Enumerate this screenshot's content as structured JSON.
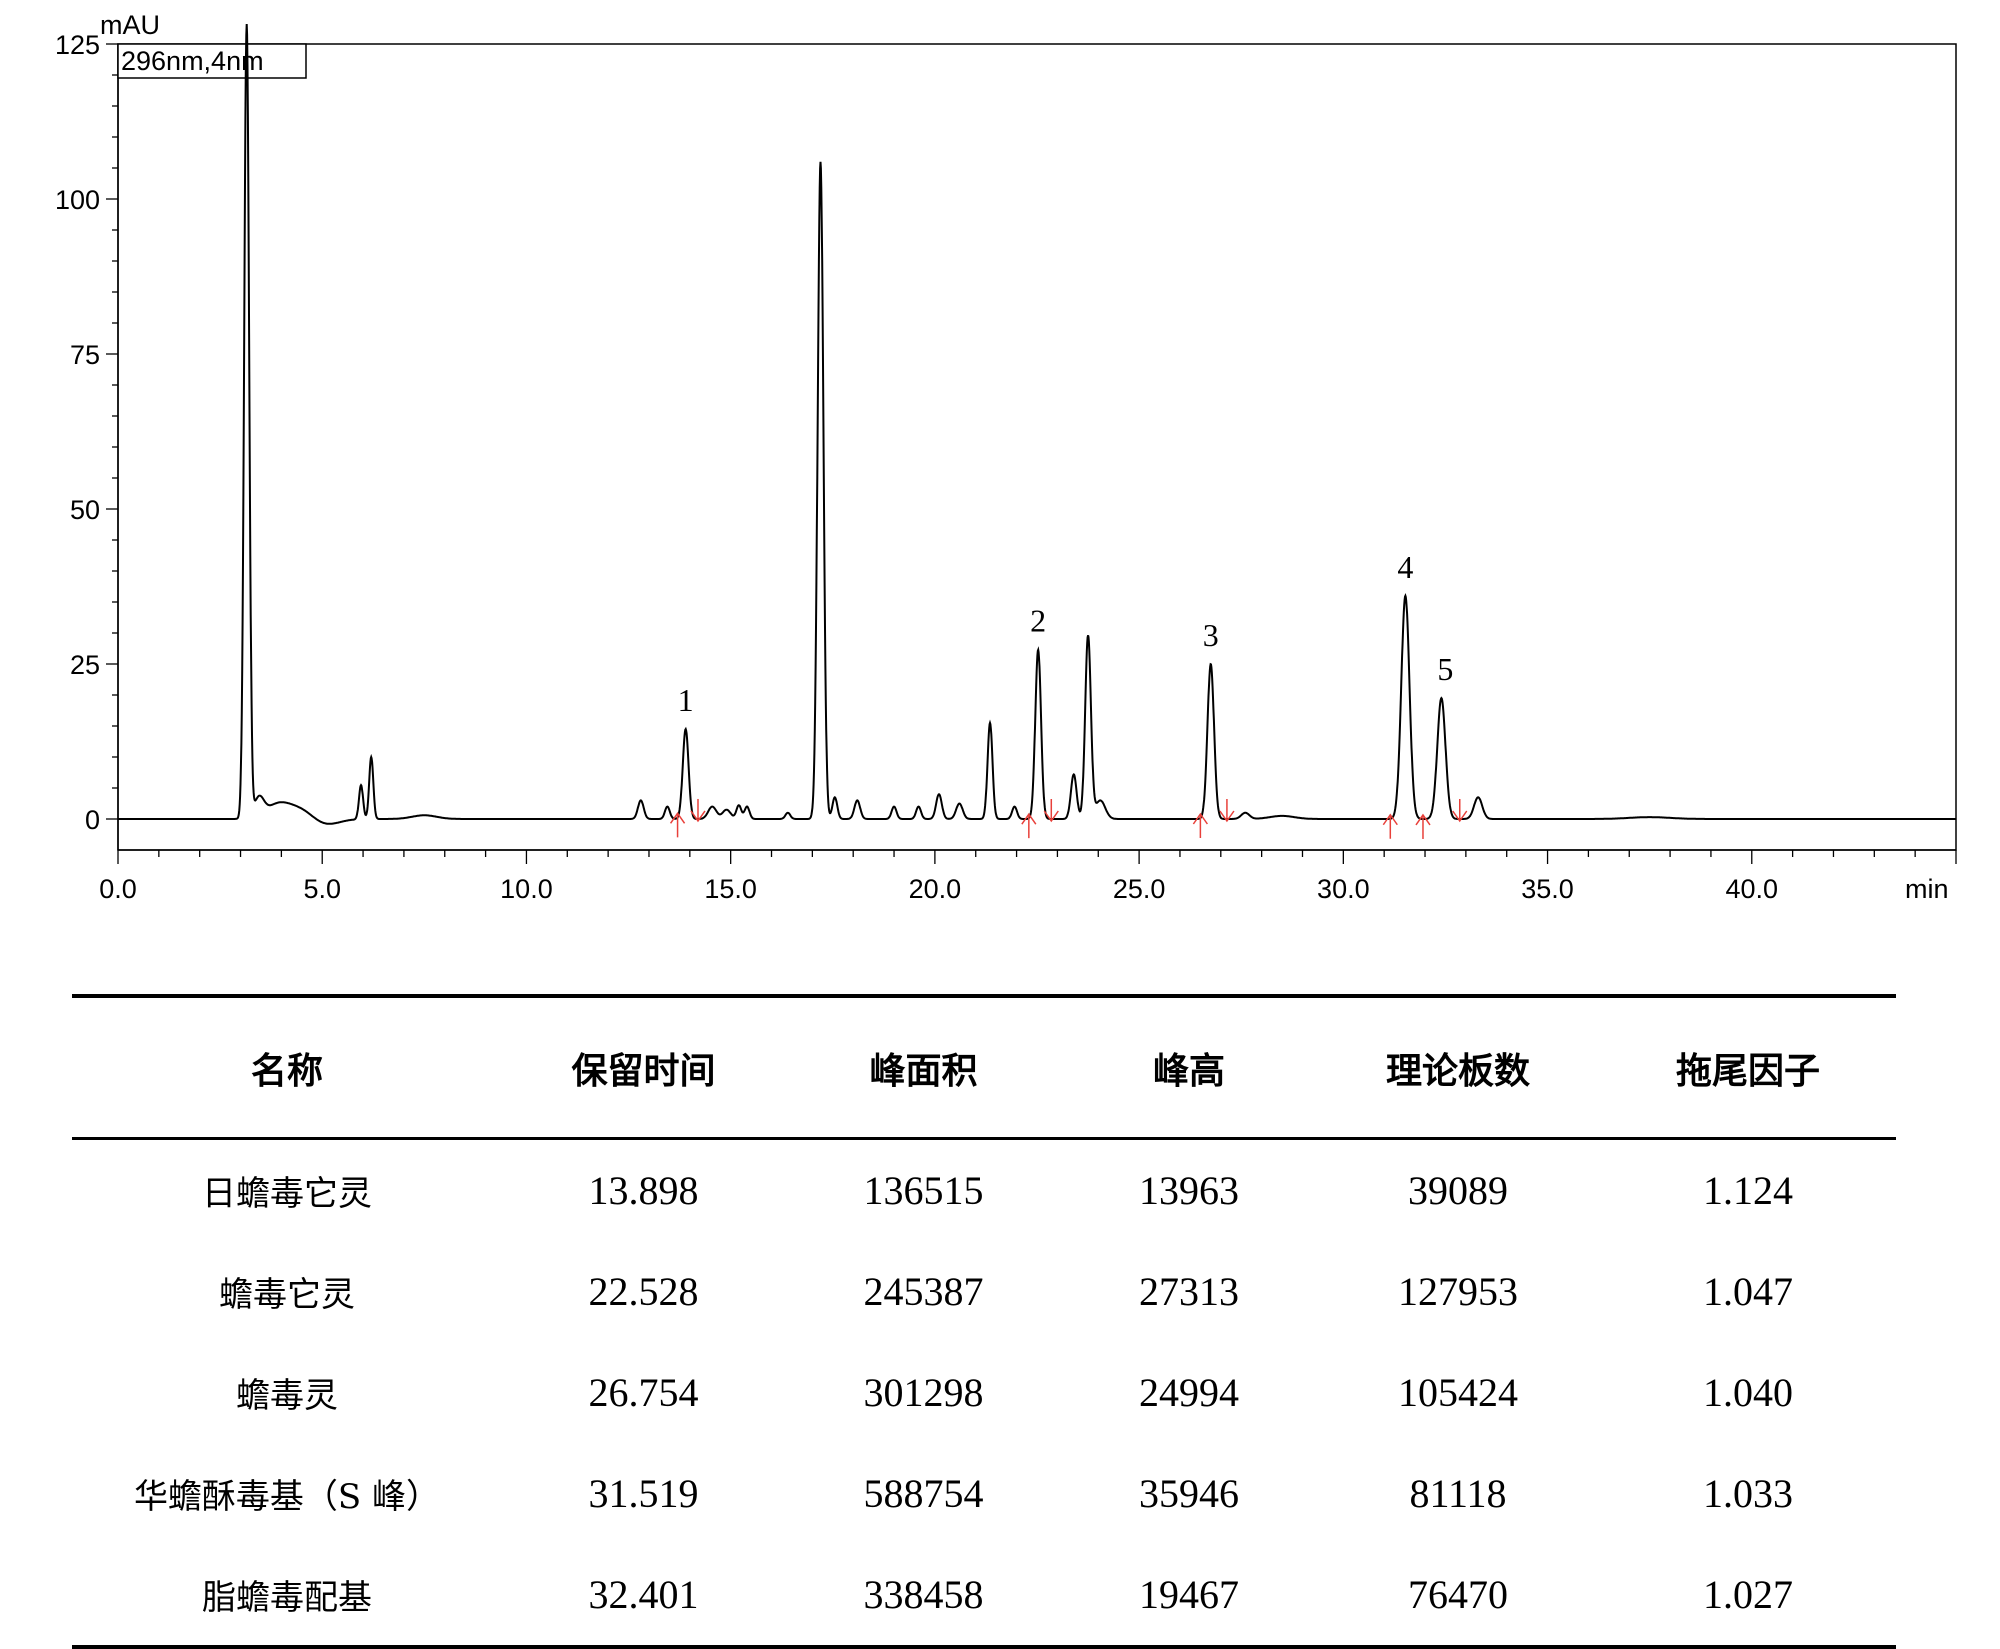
{
  "chart_data": {
    "type": "line",
    "y_unit": "mAU",
    "x_unit": "min",
    "legend": "296nm,4nm",
    "xlim": [
      0,
      45
    ],
    "ylim": [
      -5,
      125
    ],
    "x_ticks": [
      "0.0",
      "5.0",
      "10.0",
      "15.0",
      "20.0",
      "25.0",
      "30.0",
      "35.0",
      "40.0"
    ],
    "y_ticks": [
      "0",
      "25",
      "50",
      "75",
      "100",
      "125"
    ],
    "line_color": "#000000",
    "marker_color": "#e8403a",
    "peaks": [
      {
        "t": 3.15,
        "h": 128,
        "w": 0.06
      },
      {
        "t": 3.45,
        "h": 3,
        "w": 0.12
      },
      {
        "t": 3.9,
        "h": 2.2,
        "w": 0.3
      },
      {
        "t": 4.5,
        "h": 1.8,
        "w": 0.35
      },
      {
        "t": 5.95,
        "h": 5.5,
        "w": 0.05
      },
      {
        "t": 6.2,
        "h": 10,
        "w": 0.05
      },
      {
        "t": 7.5,
        "h": 0.6,
        "w": 0.3
      },
      {
        "t": 12.8,
        "h": 3,
        "w": 0.07
      },
      {
        "t": 13.45,
        "h": 2,
        "w": 0.06
      },
      {
        "t": 13.898,
        "h": 14.5,
        "w": 0.07
      },
      {
        "t": 14.55,
        "h": 2,
        "w": 0.1
      },
      {
        "t": 14.9,
        "h": 1.5,
        "w": 0.1
      },
      {
        "t": 15.2,
        "h": 2.2,
        "w": 0.06
      },
      {
        "t": 15.4,
        "h": 2,
        "w": 0.06
      },
      {
        "t": 16.4,
        "h": 1,
        "w": 0.06
      },
      {
        "t": 17.2,
        "h": 106,
        "w": 0.07
      },
      {
        "t": 17.55,
        "h": 3.5,
        "w": 0.06
      },
      {
        "t": 18.1,
        "h": 3,
        "w": 0.07
      },
      {
        "t": 19.0,
        "h": 2,
        "w": 0.06
      },
      {
        "t": 19.6,
        "h": 2,
        "w": 0.06
      },
      {
        "t": 20.1,
        "h": 4,
        "w": 0.07
      },
      {
        "t": 20.6,
        "h": 2.5,
        "w": 0.08
      },
      {
        "t": 21.35,
        "h": 15.5,
        "w": 0.06
      },
      {
        "t": 21.95,
        "h": 2,
        "w": 0.06
      },
      {
        "t": 22.528,
        "h": 27.3,
        "w": 0.07
      },
      {
        "t": 23.4,
        "h": 7.2,
        "w": 0.07
      },
      {
        "t": 23.75,
        "h": 29.5,
        "w": 0.07
      },
      {
        "t": 24.05,
        "h": 3,
        "w": 0.12
      },
      {
        "t": 26.754,
        "h": 25,
        "w": 0.08
      },
      {
        "t": 27.6,
        "h": 1,
        "w": 0.1
      },
      {
        "t": 28.5,
        "h": 0.5,
        "w": 0.3
      },
      {
        "t": 31.519,
        "h": 36,
        "w": 0.1
      },
      {
        "t": 32.401,
        "h": 19.5,
        "w": 0.1
      },
      {
        "t": 33.3,
        "h": 3.5,
        "w": 0.1
      },
      {
        "t": 37.5,
        "h": 0.3,
        "w": 0.5
      }
    ],
    "baseline_dips": [
      {
        "t": 5.0,
        "h": -1.2,
        "w": 0.35
      }
    ],
    "peak_labels": [
      {
        "label": "1",
        "t": 13.898
      },
      {
        "label": "2",
        "t": 22.528
      },
      {
        "label": "3",
        "t": 26.754
      },
      {
        "label": "4",
        "t": 31.519
      },
      {
        "label": "5",
        "t": 32.401
      }
    ],
    "integration_marks": [
      {
        "t": 13.7,
        "dir": "up"
      },
      {
        "t": 14.2,
        "dir": "down"
      },
      {
        "t": 22.3,
        "dir": "up"
      },
      {
        "t": 22.85,
        "dir": "down"
      },
      {
        "t": 26.5,
        "dir": "up"
      },
      {
        "t": 27.15,
        "dir": "down"
      },
      {
        "t": 31.15,
        "dir": "up"
      },
      {
        "t": 31.95,
        "dir": "up"
      },
      {
        "t": 32.85,
        "dir": "down"
      }
    ]
  },
  "table": {
    "headers": [
      "名称",
      "保留时间",
      "峰面积",
      "峰高",
      "理论板数",
      "拖尾因子"
    ],
    "rows": [
      [
        "日蟾毒它灵",
        "13.898",
        "136515",
        "13963",
        "39089",
        "1.124"
      ],
      [
        "蟾毒它灵",
        "22.528",
        "245387",
        "27313",
        "127953",
        "1.047"
      ],
      [
        "蟾毒灵",
        "26.754",
        "301298",
        "24994",
        "105424",
        "1.040"
      ],
      [
        "华蟾酥毒基（S 峰）",
        "31.519",
        "588754",
        "35946",
        "81118",
        "1.033"
      ],
      [
        "脂蟾毒配基",
        "32.401",
        "338458",
        "19467",
        "76470",
        "1.027"
      ]
    ]
  }
}
